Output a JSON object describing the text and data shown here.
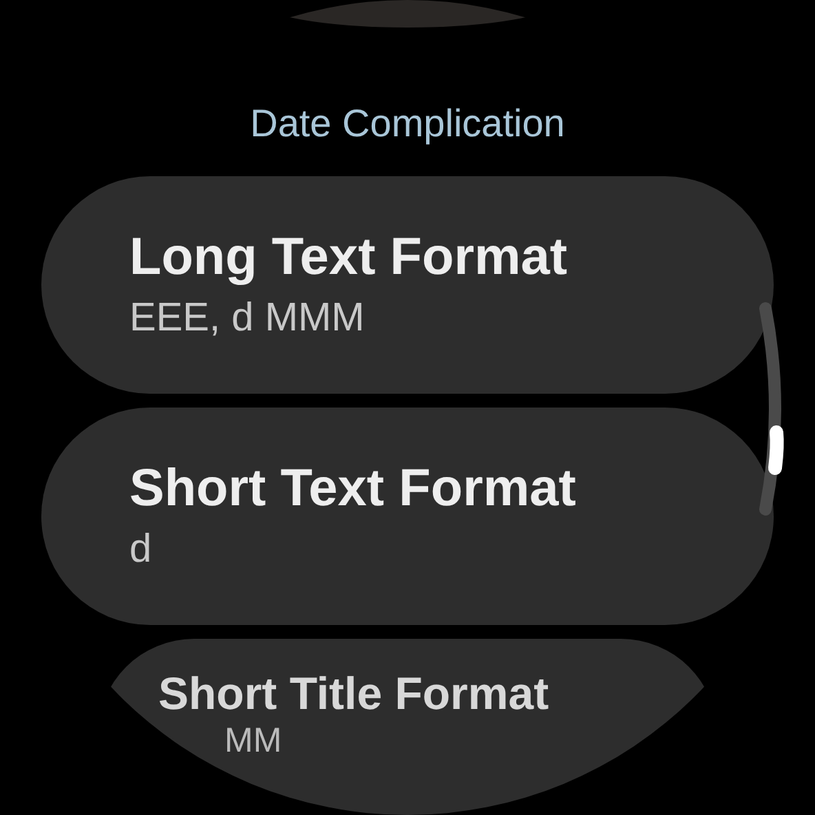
{
  "header": {
    "title": "Date Complication"
  },
  "items": [
    {
      "title": "Long Text Format",
      "subtitle": "EEE, d MMM"
    },
    {
      "title": "Short Text Format",
      "subtitle": "d"
    },
    {
      "title": "Short Title Format",
      "subtitle": "MM"
    }
  ]
}
